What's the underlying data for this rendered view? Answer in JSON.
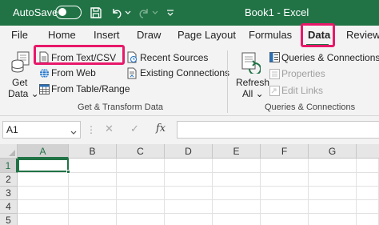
{
  "titlebar": {
    "autosave_label": "AutoSave",
    "autosave_state": "off",
    "doc_title": "Book1  -  Excel",
    "icons": [
      "save-icon",
      "undo-icon",
      "dropdown-icon",
      "redo-icon",
      "dropdown-icon",
      "customize-qat-icon"
    ]
  },
  "tabs": {
    "items": [
      "File",
      "Home",
      "Insert",
      "Draw",
      "Page Layout",
      "Formulas",
      "Data",
      "Review"
    ],
    "selected": "Data"
  },
  "ribbon": {
    "get_data": {
      "line1": "Get",
      "line2": "Data ⌄"
    },
    "from_text_csv": "From Text/CSV",
    "from_web": "From Web",
    "from_table_range": "From Table/Range",
    "recent_sources": "Recent Sources",
    "existing_connections": "Existing Connections",
    "group1_label": "Get & Transform Data",
    "refresh": {
      "line1": "Refresh",
      "line2": "All ⌄"
    },
    "queries_connections": "Queries & Connections",
    "properties": "Properties",
    "edit_links": "Edit Links",
    "group2_label": "Queries & Connections"
  },
  "formula_bar": {
    "name_box": "A1",
    "cancel_symbol": "✕",
    "enter_symbol": "✓",
    "fx_symbol": "fx",
    "formula_value": ""
  },
  "grid": {
    "columns": [
      "A",
      "B",
      "C",
      "D",
      "E",
      "F",
      "G"
    ],
    "rows": [
      "1",
      "2",
      "3",
      "4",
      "5"
    ],
    "active_cell": "A1"
  },
  "colors": {
    "excel_green": "#217346",
    "highlight_pink": "#e8186a"
  }
}
